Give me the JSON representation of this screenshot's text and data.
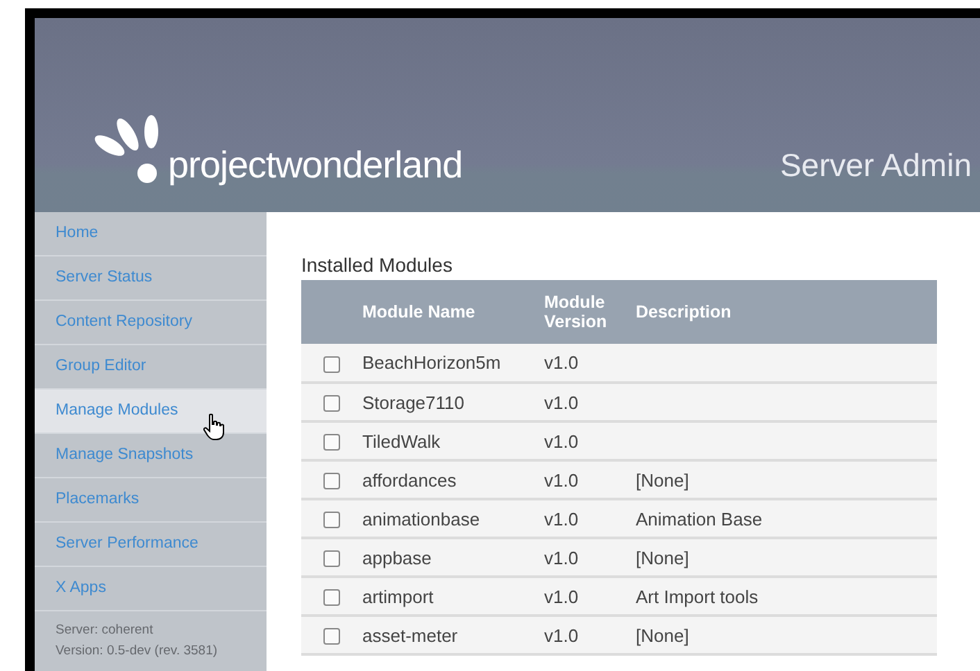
{
  "header": {
    "logo": "projectwonderland",
    "title": "Server Admin"
  },
  "sidebar": {
    "items": [
      {
        "label": "Home",
        "selected": false
      },
      {
        "label": "Server Status",
        "selected": false
      },
      {
        "label": "Content Repository",
        "selected": false
      },
      {
        "label": "Group Editor",
        "selected": false
      },
      {
        "label": "Manage Modules",
        "selected": true
      },
      {
        "label": "Manage Snapshots",
        "selected": false
      },
      {
        "label": "Placemarks",
        "selected": false
      },
      {
        "label": "Server Performance",
        "selected": false
      },
      {
        "label": "X Apps",
        "selected": false
      }
    ],
    "server": "Server: coherent",
    "version": "Version: 0.5-dev (rev. 3581)"
  },
  "content": {
    "heading": "Installed Modules",
    "table": {
      "columns": [
        "Module Name",
        "Module Version",
        "Description"
      ],
      "rows": [
        {
          "checked": false,
          "name": "BeachHorizon5m",
          "version": "v1.0",
          "description": ""
        },
        {
          "checked": false,
          "name": "Storage7110",
          "version": "v1.0",
          "description": ""
        },
        {
          "checked": false,
          "name": "TiledWalk",
          "version": "v1.0",
          "description": ""
        },
        {
          "checked": false,
          "name": "affordances",
          "version": "v1.0",
          "description": "[None]"
        },
        {
          "checked": false,
          "name": "animationbase",
          "version": "v1.0",
          "description": "Animation Base"
        },
        {
          "checked": false,
          "name": "appbase",
          "version": "v1.0",
          "description": "[None]"
        },
        {
          "checked": false,
          "name": "artimport",
          "version": "v1.0",
          "description": "Art Import tools"
        },
        {
          "checked": false,
          "name": "asset-meter",
          "version": "v1.0",
          "description": "[None]"
        }
      ]
    }
  }
}
